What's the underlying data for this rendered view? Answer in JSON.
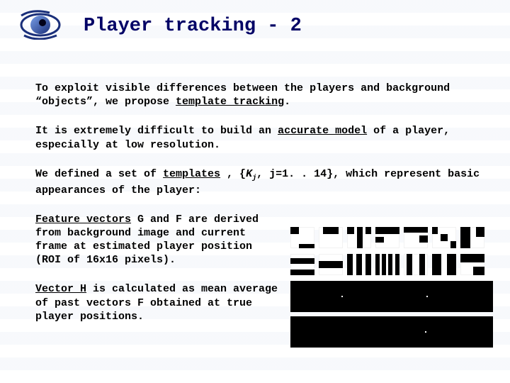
{
  "title": "Player tracking - 2",
  "para1": {
    "pre": "To exploit visible differences between the players and background “objects”, we propose ",
    "u": "template tracking",
    "post": "."
  },
  "para2": {
    "pre": "It is extremely difficult to build an ",
    "u": "accurate model",
    "post": " of a player, especially at low resolution."
  },
  "para3": {
    "pre": "We defined a set of ",
    "u": "templates",
    "mid": " , {",
    "k": "K",
    "sub": "j",
    "range": ", j=1. . 14",
    "post": "}, which represent basic appearances of the player:"
  },
  "para4": {
    "u": "Feature vectors",
    "post": " G and F are derived from background image and current frame at estimated player position (ROI of 16x16 pixels)."
  },
  "para5": {
    "u": "Vector H",
    "post": " is calculated as mean average of past vectors F obtained at true player positions."
  },
  "logo_alt": "eye-logo"
}
